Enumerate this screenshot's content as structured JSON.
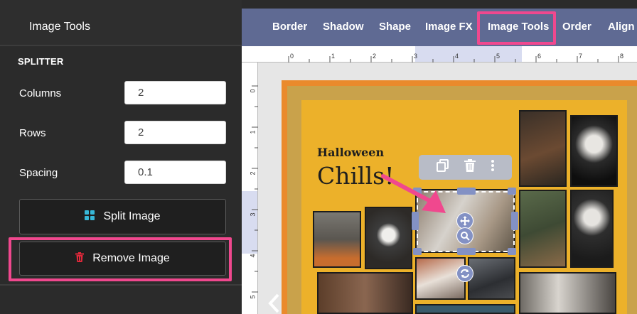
{
  "sidebar": {
    "title": "Image Tools",
    "section_title": "SPLITTER",
    "fields": [
      {
        "label": "Columns",
        "value": "2"
      },
      {
        "label": "Rows",
        "value": "2"
      },
      {
        "label": "Spacing",
        "value": "0.1"
      }
    ],
    "split_button": "Split Image",
    "remove_button": "Remove Image"
  },
  "tabs": [
    {
      "label": "Border"
    },
    {
      "label": "Shadow"
    },
    {
      "label": "Shape"
    },
    {
      "label": "Image FX"
    },
    {
      "label": "Image Tools"
    },
    {
      "label": "Order"
    },
    {
      "label": "Align"
    }
  ],
  "ruler": {
    "top_numbers": [
      "0",
      "1",
      "2",
      "3",
      "4",
      "5",
      "6",
      "7",
      "8"
    ],
    "left_numbers": [
      "0",
      "1",
      "2",
      "3",
      "4",
      "5"
    ]
  },
  "page": {
    "title_small": "Halloween",
    "title_large": "Chills!"
  },
  "colors": {
    "highlight": "#f0488e",
    "tabbar": "#5f6a93",
    "handle": "#8391c4",
    "page_yellow": "#ecb12a",
    "page_orange": "#ea8a2c"
  }
}
